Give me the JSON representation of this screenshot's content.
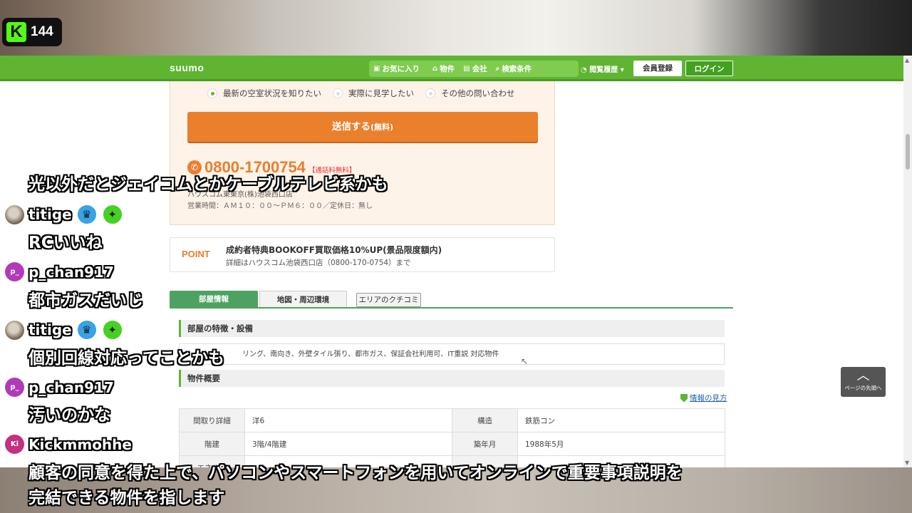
{
  "stream": {
    "platform_icon": "kick-logo-icon",
    "kick_letter": "K",
    "viewer_count": "144"
  },
  "header": {
    "logo": "suumo",
    "favorites": "お気に入り",
    "properties": "物件",
    "companies": "会社",
    "search_conditions": "検索条件",
    "history": "閲覧履歴",
    "register": "会員登録",
    "login": "ログイン"
  },
  "contact": {
    "options": [
      "最新の空室状況を知りたい",
      "実際に見学したい",
      "その他の問い合わせ"
    ],
    "selected_index": 0,
    "send_button": "送信する",
    "send_free": "(無料)",
    "phone": "0800-1700754",
    "phone_note": "【通話料無料】",
    "shop": "ハウスコム東東京(株)池袋西口店",
    "hours": "営業時間：ＡＭ１０：００～ＰＭ６：００／定休日：無し"
  },
  "point": {
    "label": "POINT",
    "title": "成約者特典BOOKOFF買取価格10%UP(景品限度額内)",
    "detail": "詳細はハウスコム池袋西口店（0800-170-0754）まで"
  },
  "tabs": {
    "room_info": "部屋情報",
    "map": "地図・周辺環境",
    "area_review": "エリアのクチコミ"
  },
  "features": {
    "heading": "部屋の特徴・設備",
    "body": "リング、南向き、外壁タイル張り、都市ガス、保証会社利用可、IT重説 対応物件"
  },
  "overview": {
    "heading": "物件概要",
    "help_link": "情報の見方",
    "rows": [
      {
        "label1": "間取り詳細",
        "value1": "洋6",
        "label2": "構造",
        "value2": "鉄筋コン"
      },
      {
        "label1": "階建",
        "value1": "3階/4階建",
        "label2": "築年月",
        "value2": "1988年5月"
      },
      {
        "label1": "エネルギ",
        "value1": "",
        "label2": "",
        "value2": ""
      }
    ]
  },
  "to_top": {
    "label": "ページの先頭へ"
  },
  "chat": {
    "caption_top": "光以外だとジェイコムとかケーブルテレビ系かも",
    "messages": [
      {
        "user": "titige",
        "avatar": "",
        "text": "RCいいね",
        "badges": [
          "crown-badge-icon",
          "star-badge-icon"
        ]
      },
      {
        "user": "p_chan917",
        "avatar": "p_",
        "text": "都市ガスだいじ",
        "badges": []
      },
      {
        "user": "titige",
        "avatar": "",
        "text": "個別回線対応ってことかも",
        "badges": [
          "crown-badge-icon",
          "star-badge-icon"
        ]
      },
      {
        "user": "p_chan917",
        "avatar": "p_",
        "text": "汚いのかな",
        "badges": []
      },
      {
        "user": "Kickmmohhe",
        "avatar": "Ki",
        "text": "",
        "badges": []
      }
    ],
    "caption_bottom_1": "顧客の同意を得た上で、パソコンやスマートフォンを用いてオンラインで重要事項説明を",
    "caption_bottom_2": "完結できる物件を指します"
  }
}
